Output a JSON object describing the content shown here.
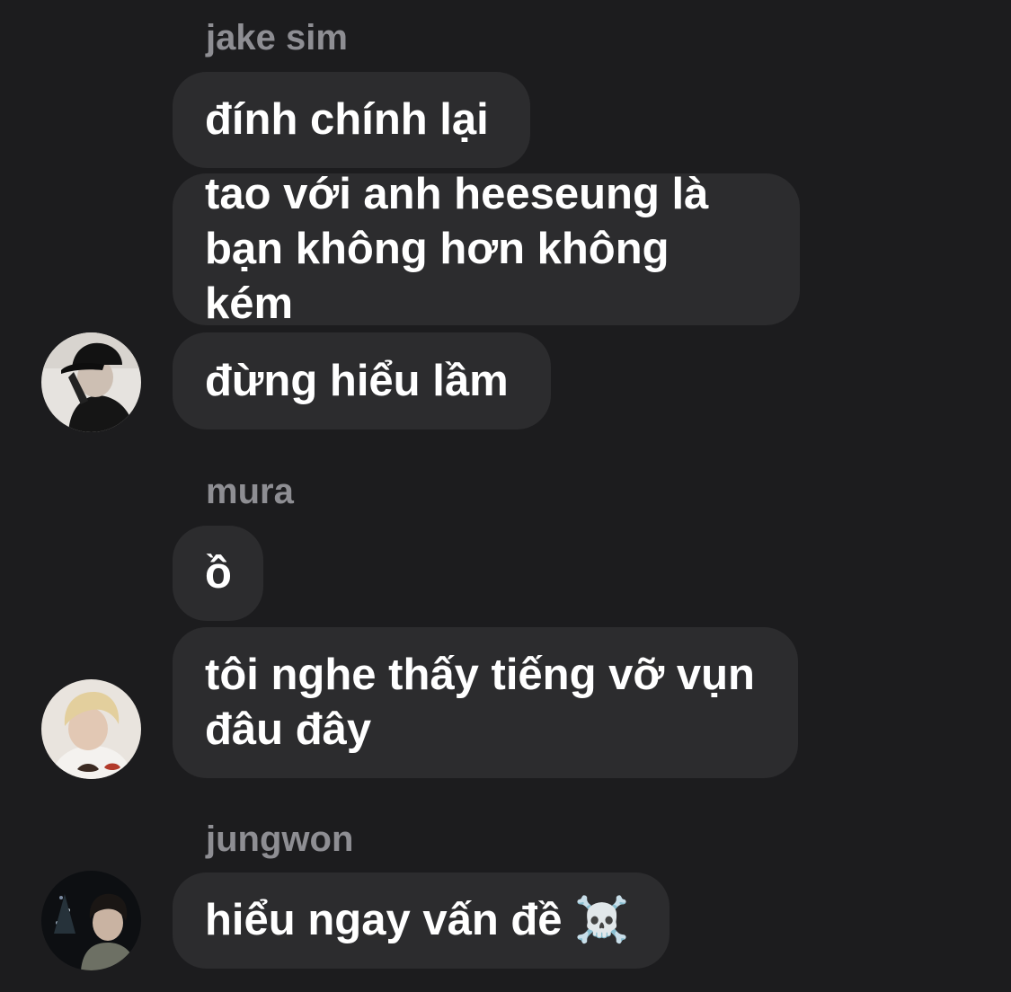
{
  "groups": [
    {
      "sender": "jake sim",
      "avatar": "avatar-black-cap-photo",
      "messages": [
        "đính chính lại",
        "tao với anh heeseung là\nbạn không hơn không kém",
        "đừng hiểu lầm"
      ]
    },
    {
      "sender": "mura",
      "avatar": "avatar-blonde-hair-photo",
      "messages": [
        "ồ",
        "tôi nghe thấy tiếng vỡ vụn\nđâu đây"
      ]
    },
    {
      "sender": "jungwon",
      "avatar": "avatar-night-photo",
      "messages": [
        "hiểu ngay vấn đề ☠️"
      ]
    }
  ]
}
